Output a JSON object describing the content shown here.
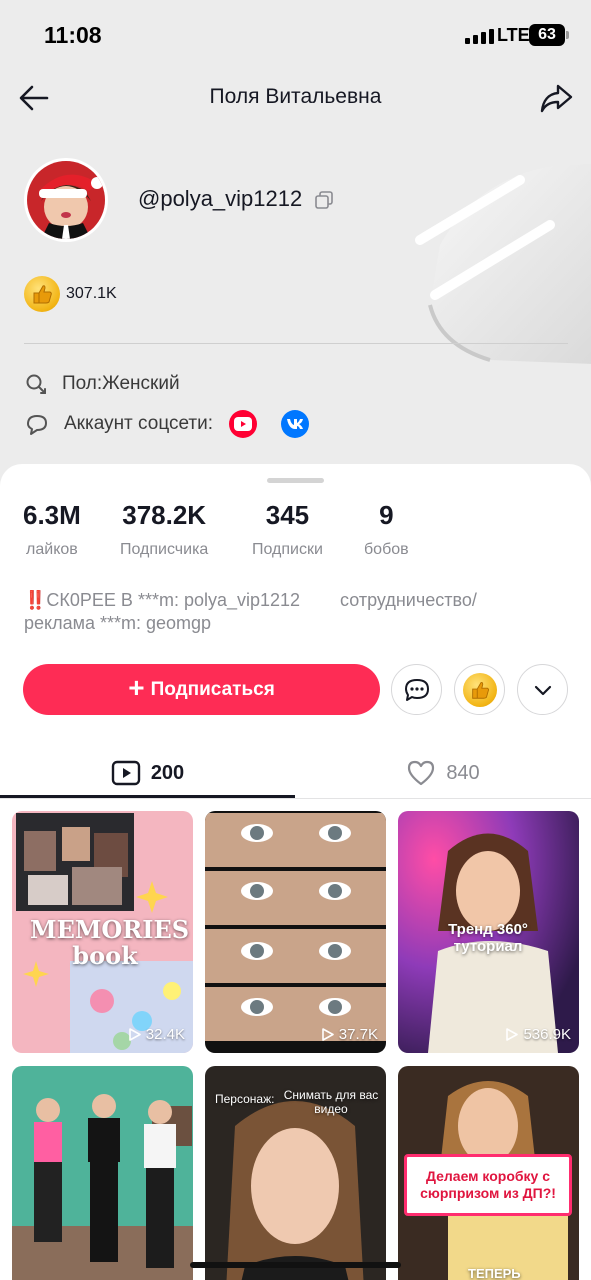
{
  "status_bar": {
    "time": "11:08",
    "network": "LTE",
    "battery": "63"
  },
  "nav": {
    "title": "Поля Витальевна",
    "back_icon": "back-arrow-icon",
    "share_icon": "share-icon"
  },
  "profile": {
    "username": "@polya_vip1212",
    "coins": "307.1K",
    "gender": "Пол:Женский",
    "social_label": "Аккаунт соцсети:"
  },
  "stats": [
    {
      "value": "6.3M",
      "label": "лайков"
    },
    {
      "value": "378.2K",
      "label": "Подписчика"
    },
    {
      "value": "345",
      "label": "Подписки"
    },
    {
      "value": "9",
      "label": "бобов"
    }
  ],
  "bio": {
    "emoji": "‼️",
    "text": "СК0РЕЕ В ***m: polya_vip1212        сотрудничество/\nреклама ***m: geomgp"
  },
  "actions": {
    "follow": "Подписаться"
  },
  "tabs": {
    "videos_count": "200",
    "likes_count": "840"
  },
  "videos": [
    {
      "views": "32.4K",
      "overlay": "MEMORIES book"
    },
    {
      "views": "37.7K",
      "overlay": ""
    },
    {
      "views": "536.9K",
      "overlay": "Тренд 360° туториал"
    },
    {
      "views": "",
      "overlay": ""
    },
    {
      "views": "",
      "overlay_left": "Персонаж:",
      "overlay_right": "Снимать для вас видео"
    },
    {
      "views": "",
      "overlay": "Делаем коробку с сюрпризом из ДП?!",
      "overlay_bottom": "ТЕПЕРЬ"
    }
  ],
  "colors": {
    "accent": "#fe2c55",
    "youtube": "#ff0033",
    "vk": "#0077ff"
  }
}
